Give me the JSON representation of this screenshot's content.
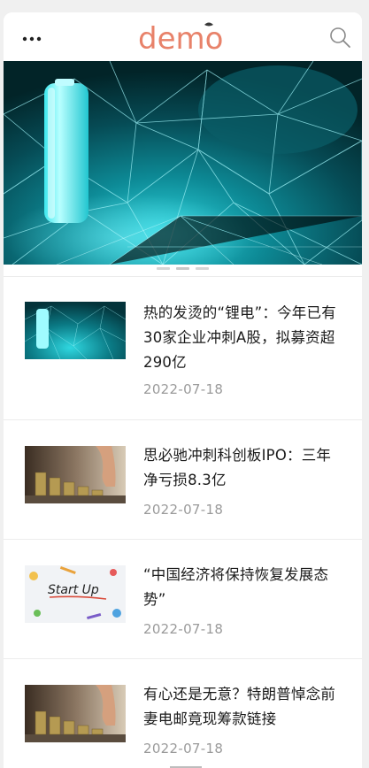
{
  "header": {
    "logo_text": "demo",
    "brand_color": "#e8826a",
    "menu_icon": "more-dots-icon",
    "search_icon": "search-icon"
  },
  "banner": {
    "image": "lithium-battery-network-image",
    "slides": 3,
    "active_slide": 1
  },
  "news": [
    {
      "title": "热的发烫的“锂电”：今年已有30家企业冲刺A股，拟募资超290亿",
      "date": "2022-07-18",
      "thumb": "lithium-battery-thumbnail"
    },
    {
      "title": "思必驰冲刺科创板IPO：三年净亏损8.3亿",
      "date": "2022-07-18",
      "thumb": "coin-stacks-thumbnail"
    },
    {
      "title": "“中国经济将保持恢复发展态势”",
      "date": "2022-07-18",
      "thumb": "start-up-thumbnail",
      "thumb_text": "Start Up"
    },
    {
      "title": "有心还是无意？特朗普悼念前妻电邮竟现筹款链接",
      "date": "2022-07-18",
      "thumb": "coin-stacks-thumbnail"
    }
  ]
}
